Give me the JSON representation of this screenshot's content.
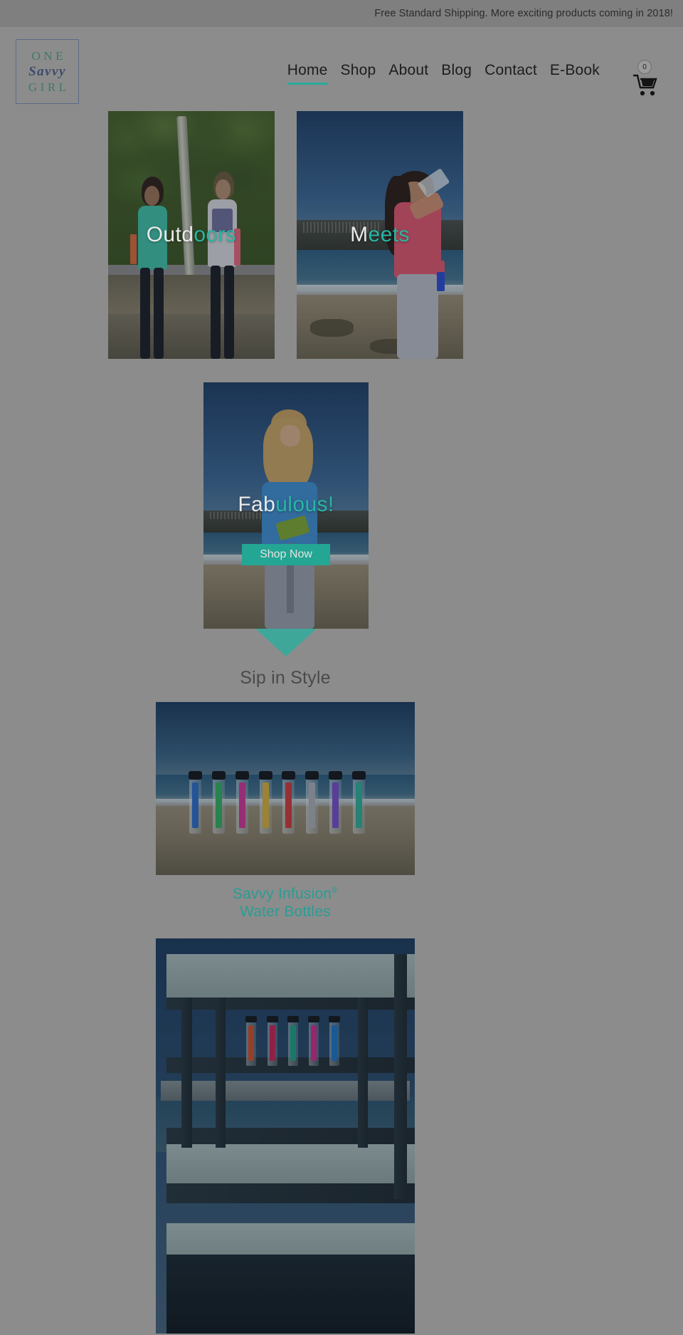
{
  "announcement": {
    "text": "Free Standard Shipping.  More exciting products coming in 2018!"
  },
  "logo": {
    "line1": "ONE",
    "line2": "Savvy",
    "line3": "GIRL",
    "color_one": "#3e7a63",
    "color_savvy": "#3d4a6b",
    "border_color": "#5b6a86"
  },
  "nav": {
    "items": [
      {
        "label": "Home",
        "active": true
      },
      {
        "label": "Shop",
        "active": false
      },
      {
        "label": "About",
        "active": false
      },
      {
        "label": "Blog",
        "active": false
      },
      {
        "label": "Contact",
        "active": false
      },
      {
        "label": "E-Book",
        "active": false
      }
    ],
    "active_underline_color": "#2aa99a"
  },
  "cart": {
    "icon": "shopping-cart-icon",
    "count": "0"
  },
  "tiles": [
    {
      "id": "outdoors",
      "caption_white": "Outd",
      "caption_teal": "oors",
      "alt": "Two women jogging outdoors on a park trail holding infusion water bottles"
    },
    {
      "id": "meets",
      "caption_white": "M",
      "caption_teal": "eets",
      "alt": "Woman in pink long sleeve top drinking from an infusion water bottle at the beach"
    },
    {
      "id": "fabulous",
      "caption_white": "Fab",
      "caption_teal": "ulous!",
      "button_label": "Shop Now",
      "button_color": "#23a693",
      "alt": "Blonde woman in blue top holding a green infusion water bottle on the beach"
    }
  ],
  "arrow": {
    "name": "down-arrow",
    "color": "#3fa79a"
  },
  "section": {
    "title": "Sip in Style",
    "title_color": "#4a4a4a"
  },
  "products": [
    {
      "id": "bottles-beach",
      "alt": "Row of colorful Savvy Infusion water bottles standing in beach sand at sunset",
      "caption_line1": "Savvy Infusion",
      "caption_superscript": "®",
      "caption_line2": "Water Bottles",
      "caption_color": "#2a9d93"
    },
    {
      "id": "bottles-rail",
      "alt": "Colorful Savvy Infusion water bottles lined up on a blue lifeguard tower railing"
    }
  ],
  "theme": {
    "page_background": "#8c8c8c",
    "announcement_background": "#7f7f7f",
    "teal": "#29b5a2",
    "text_dark": "#1d1d1d"
  }
}
